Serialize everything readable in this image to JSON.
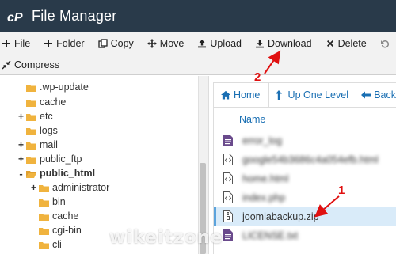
{
  "titlebar": {
    "title": "File Manager"
  },
  "toolbar": {
    "row1": [
      {
        "label": "File",
        "icon": "plus-icon"
      },
      {
        "label": "Folder",
        "icon": "plus-icon"
      },
      {
        "label": "Copy",
        "icon": "copy-icon"
      },
      {
        "label": "Move",
        "icon": "move-icon"
      },
      {
        "label": "Upload",
        "icon": "upload-icon"
      },
      {
        "label": "Download",
        "icon": "download-icon"
      },
      {
        "label": "Delete",
        "icon": "close-icon"
      }
    ],
    "row2": [
      {
        "label": "Compress",
        "icon": "compress-icon"
      }
    ]
  },
  "tree": {
    "items": [
      {
        "label": ".wp-update",
        "expander": ""
      },
      {
        "label": "cache",
        "expander": ""
      },
      {
        "label": "etc",
        "expander": "+"
      },
      {
        "label": "logs",
        "expander": ""
      },
      {
        "label": "mail",
        "expander": "+"
      },
      {
        "label": "public_ftp",
        "expander": "+"
      },
      {
        "label": "public_html",
        "expander": "-"
      },
      {
        "label": "administrator",
        "expander": "+"
      },
      {
        "label": "bin",
        "expander": ""
      },
      {
        "label": "cache",
        "expander": ""
      },
      {
        "label": "cgi-bin",
        "expander": ""
      },
      {
        "label": "cli",
        "expander": ""
      }
    ]
  },
  "nav": {
    "home": "Home",
    "up": "Up One Level",
    "back": "Back"
  },
  "filelist": {
    "column_name": "Name",
    "files": [
      {
        "name": "error_log",
        "icon": "document-icon",
        "blurred": true
      },
      {
        "name": "google54b3686c4a054efb.html",
        "icon": "code-file-icon",
        "blurred": true
      },
      {
        "name": "home.html",
        "icon": "code-file-icon",
        "blurred": true
      },
      {
        "name": "index.php",
        "icon": "code-file-icon",
        "blurred": true
      },
      {
        "name": "joomlabackup.zip",
        "icon": "zip-file-icon",
        "blurred": false,
        "selected": true
      },
      {
        "name": "LICENSE.txt",
        "icon": "document-icon",
        "blurred": true
      }
    ]
  },
  "annotations": {
    "step1": "1",
    "step2": "2"
  },
  "watermark": "wikeitzone",
  "colors": {
    "titlebar": "#293a4a",
    "link": "#1a6fb3",
    "selected_row": "#d9ebf9",
    "annotation": "#e01010",
    "folder": "#f0b33e"
  }
}
